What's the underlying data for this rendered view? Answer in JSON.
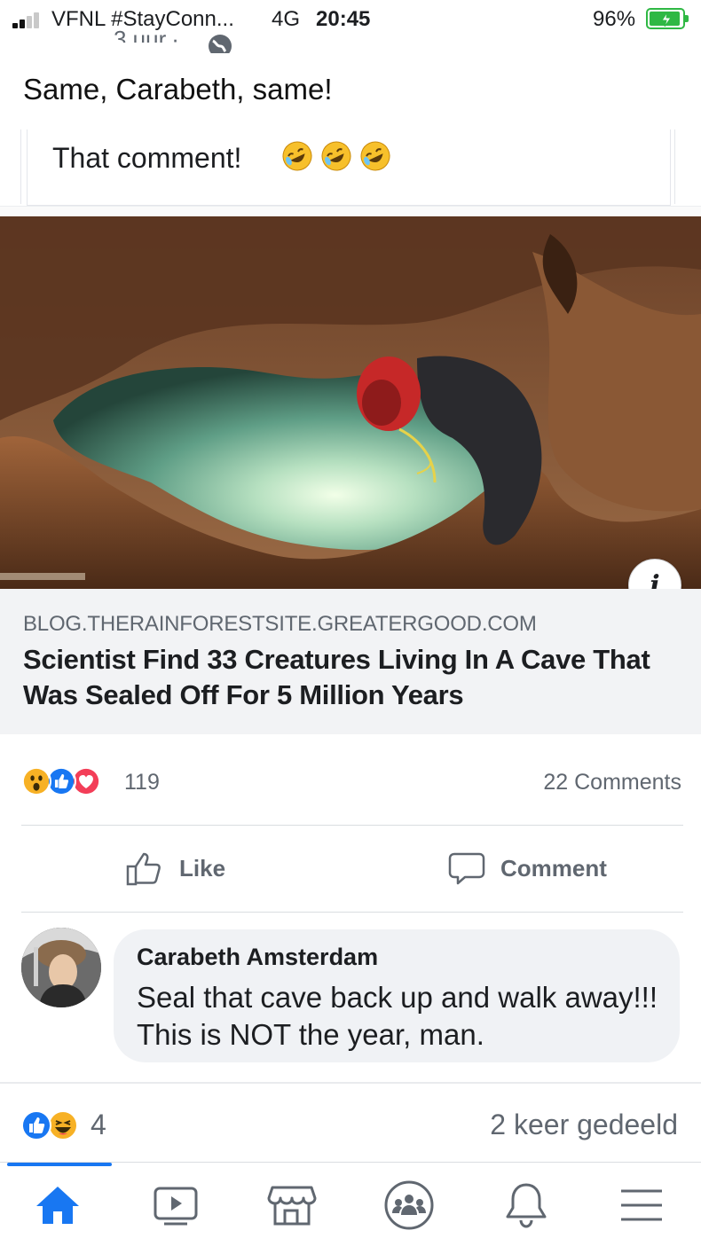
{
  "status_bar": {
    "carrier": "VFNL #StayConn...",
    "network": "4G",
    "time": "20:45",
    "battery": "96%",
    "battery_level": 0.96,
    "post_time_clipped": "3 uur"
  },
  "post": {
    "text": "Same, Carabeth, same!",
    "quoted_comment": "That comment!",
    "emoji_icons": [
      "rolling-on-floor-laughing-emoji",
      "rolling-on-floor-laughing-emoji",
      "rolling-on-floor-laughing-emoji"
    ]
  },
  "link_preview": {
    "domain": "BLOG.THERAINFORESTSITE.GREATERGOOD.COM",
    "title": "Scientist Find 33 Creatures Living In A Cave That Was Sealed Off For 5 Million Years",
    "info_label": "i"
  },
  "reactions": {
    "icons": [
      "wow-icon",
      "like-icon",
      "love-icon"
    ],
    "count": "119",
    "comments": "22 Comments"
  },
  "actions": {
    "like": "Like",
    "comment": "Comment"
  },
  "comment": {
    "author": "Carabeth Amsterdam",
    "text": "Seal that cave back up and walk away!!! This is NOT the year, man."
  },
  "footer": {
    "reaction_icons": [
      "like-icon",
      "haha-icon"
    ],
    "reaction_count": "4",
    "shares": "2 keer gedeeld"
  },
  "nav": {
    "items": [
      "home-icon",
      "watch-icon",
      "marketplace-icon",
      "groups-icon",
      "notifications-icon",
      "menu-icon"
    ],
    "active": "home-icon"
  },
  "colors": {
    "accent": "#1877f2",
    "battery": "#2fb844",
    "love": "#f33e58",
    "reaction_yellow": "#f7b125"
  }
}
